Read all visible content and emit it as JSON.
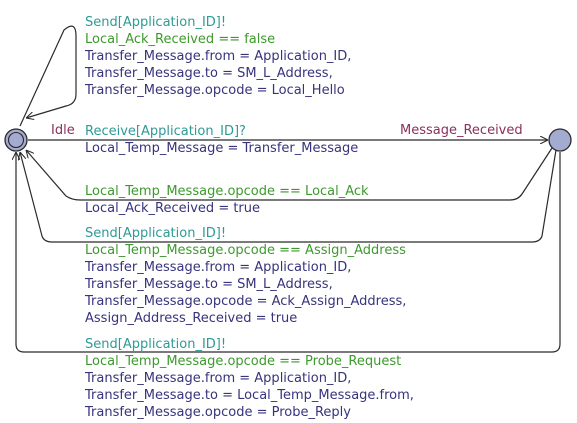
{
  "colors": {
    "edge": "#2b2b2b",
    "location_fill": "#a3abd0",
    "location_stroke": "#2b2b2b",
    "sync": "#2e9a96",
    "guard": "#3c9a2c",
    "assign": "#37337c",
    "location_name": "#8a2f5c"
  },
  "locations": {
    "idle": {
      "name": "Idle",
      "initial": true
    },
    "message_received": {
      "name": "Message_Received",
      "initial": false
    }
  },
  "edges": {
    "self_loop": {
      "sync": "Send[Application_ID]!",
      "guard": "Local_Ack_Received == false",
      "assign": [
        "Transfer_Message.from = Application_ID,",
        "Transfer_Message.to = SM_L_Address,",
        "Transfer_Message.opcode = Local_Hello"
      ]
    },
    "receive": {
      "sync": "Receive[Application_ID]?",
      "assign": [
        "Local_Temp_Message = Transfer_Message"
      ]
    },
    "local_ack": {
      "guard": "Local_Temp_Message.opcode == Local_Ack",
      "assign": [
        "Local_Ack_Received = true"
      ]
    },
    "assign_address": {
      "sync": "Send[Application_ID]!",
      "guard": "Local_Temp_Message.opcode == Assign_Address",
      "assign": [
        "Transfer_Message.from = Application_ID,",
        "Transfer_Message.to = SM_L_Address,",
        "Transfer_Message.opcode = Ack_Assign_Address,",
        "Assign_Address_Received = true"
      ]
    },
    "probe_request": {
      "sync": "Send[Application_ID]!",
      "guard": "Local_Temp_Message.opcode == Probe_Request",
      "assign": [
        "Transfer_Message.from = Application_ID,",
        "Transfer_Message.to = Local_Temp_Message.from,",
        "Transfer_Message.opcode = Probe_Reply"
      ]
    }
  }
}
